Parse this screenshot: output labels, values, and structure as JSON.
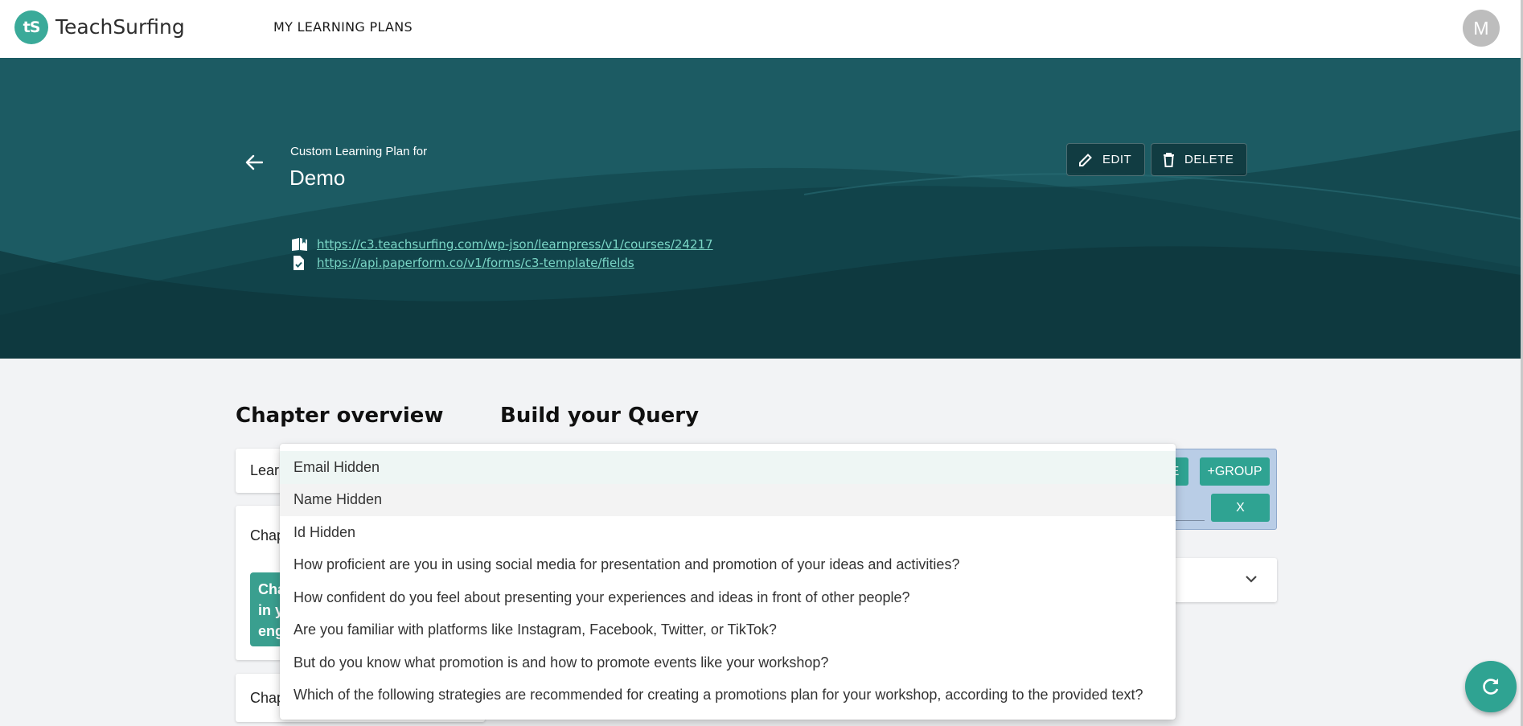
{
  "app": {
    "logo_text": "tS",
    "brand": "TeachSurfing",
    "nav_link": "MY LEARNING PLANS",
    "avatar_initial": "M"
  },
  "colors": {
    "accent": "#2fa392",
    "hero_bg": "#1c5b63",
    "link": "#7ad6c6"
  },
  "hero": {
    "subtitle": "Custom Learning Plan for",
    "title": "Demo",
    "links": [
      {
        "icon": "book-icon",
        "url": "https://c3.teachsurfing.com/wp-json/learnpress/v1/courses/24217"
      },
      {
        "icon": "form-check-icon",
        "url": "https://api.paperform.co/v1/forms/c3-template/fields"
      }
    ],
    "edit_label": "EDIT",
    "delete_label": "DELETE"
  },
  "sections": {
    "chapter_overview": "Chapter overview",
    "build_query": "Build your Query"
  },
  "chapter_cards": {
    "card1_label": "Lear",
    "card2_label": "Chap",
    "card2_block_lines": [
      "Cha",
      "in y",
      "eng"
    ],
    "card3_label": "Chap"
  },
  "query": {
    "partial_button": "E",
    "group_button": "+GROUP",
    "remove_button": "X"
  },
  "dropdown": {
    "options": [
      "Email Hidden",
      "Name Hidden",
      "Id Hidden",
      "How proficient are you in using social media for presentation and promotion of your ideas and activities?",
      "How confident do you feel about presenting your experiences and ideas in front of other people?",
      "Are you familiar with platforms like Instagram, Facebook, Twitter, or TikTok?",
      "But do you know what promotion is and how to promote events like your workshop?",
      "Which of the following strategies are recommended for creating a promotions plan for your workshop, according to the provided text?"
    ]
  }
}
